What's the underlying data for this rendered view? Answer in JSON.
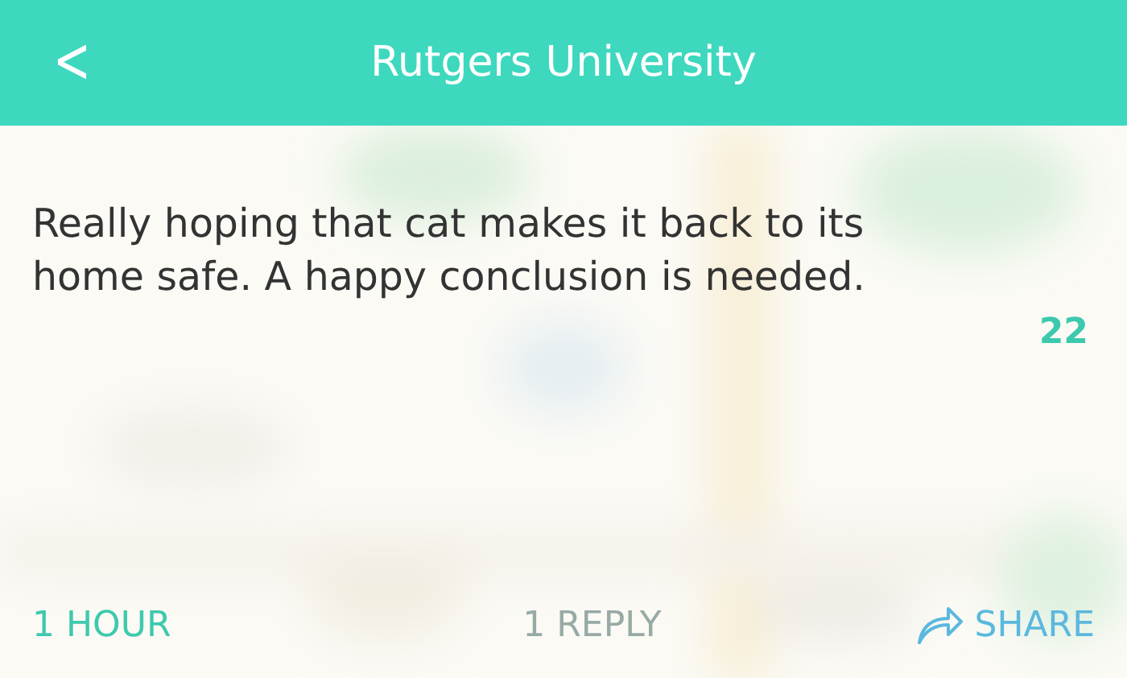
{
  "header": {
    "back_icon": "<",
    "title": "Rutgers University"
  },
  "post": {
    "kind": "picture",
    "text": "Really hoping that cat makes it back to its home safe. A happy conclusion is needed.",
    "votes": "22"
  },
  "footer": {
    "time": "1 HOUR",
    "replies": "1 REPLY",
    "share": "SHARE"
  }
}
